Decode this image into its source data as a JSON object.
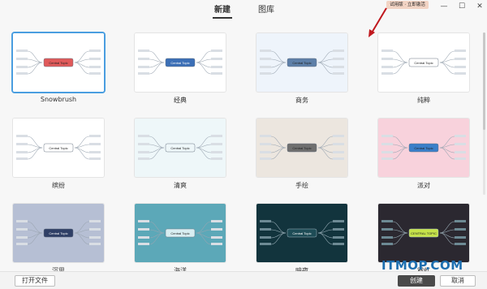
{
  "tabs": [
    {
      "label": "新建"
    },
    {
      "label": "图库"
    }
  ],
  "trial_badge": "试用版 · 立即激活",
  "window_controls": {
    "minimize": "—",
    "maximize": "☐",
    "close": "✕"
  },
  "templates": [
    {
      "name": "Snowbrush",
      "bg": "#ffffff",
      "node": "#e05a5a",
      "topic": "Central Topic",
      "selected": true
    },
    {
      "name": "经典",
      "bg": "#ffffff",
      "node": "#3b6fb6",
      "topic": "Central Topic",
      "selected": false
    },
    {
      "name": "商务",
      "bg": "#eef4fb",
      "node": "#5d7fa8",
      "topic": "Central Topic",
      "selected": false
    },
    {
      "name": "纯粹",
      "bg": "#ffffff",
      "node": "#ffffff",
      "topic": "Central Topic",
      "selected": false
    },
    {
      "name": "缤纷",
      "bg": "#ffffff",
      "node": "#ffffff",
      "topic": "Central Topic",
      "selected": false
    },
    {
      "name": "清爽",
      "bg": "#eef7f9",
      "node": "#eef7f9",
      "topic": "Central Topic",
      "selected": false
    },
    {
      "name": "手绘",
      "bg": "#ece6df",
      "node": "#6f6f6f",
      "topic": "Central Topic",
      "selected": false
    },
    {
      "name": "派对",
      "bg": "#f8d2dc",
      "node": "#3a7fc9",
      "topic": "Central Topic",
      "selected": false
    },
    {
      "name": "沉思",
      "bg": "#b6bfd4",
      "node": "#2f3f66",
      "topic": "Central Topic",
      "selected": false
    },
    {
      "name": "海洋",
      "bg": "#5ca8b8",
      "node": "#d8eef2",
      "topic": "Central Topic",
      "selected": false
    },
    {
      "name": "暗夜",
      "bg": "#12343d",
      "node": "#1e4c56",
      "topic": "Central Topic",
      "selected": false
    },
    {
      "name": "霓虹",
      "bg": "#2b2830",
      "node": "#c6e34a",
      "topic": "CENTRAL TOPIC",
      "selected": false
    }
  ],
  "footer": {
    "open_file": "打开文件",
    "create": "创建",
    "cancel": "取消"
  },
  "watermark": "ITMOP.COM"
}
